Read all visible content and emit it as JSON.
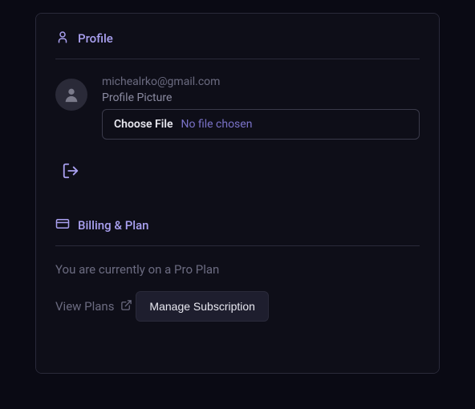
{
  "profile": {
    "title": "Profile",
    "email": "michealrko@gmail.com",
    "picture_label": "Profile Picture",
    "choose_file": "Choose File",
    "file_status": "No file chosen"
  },
  "billing": {
    "title": "Billing & Plan",
    "current_plan_text": "You are currently on a Pro Plan",
    "view_plans": "View Plans",
    "manage_button": "Manage Subscription"
  }
}
